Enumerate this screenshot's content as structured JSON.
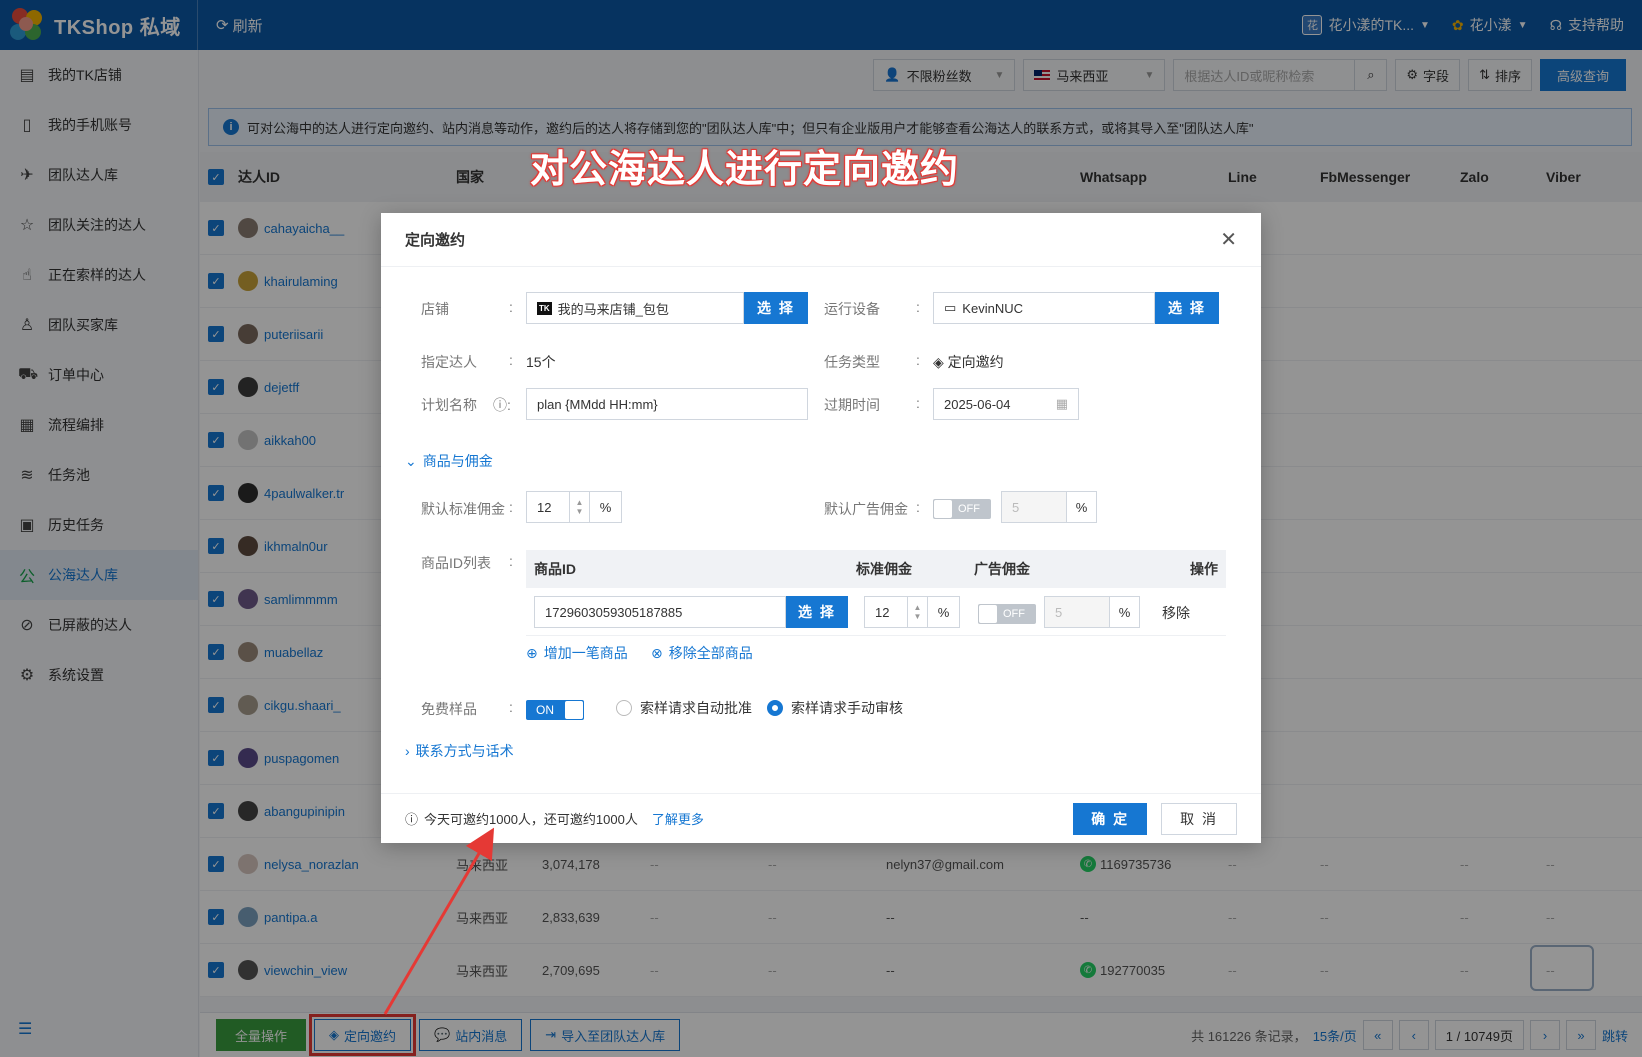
{
  "app": {
    "title": "TKShop 私域",
    "refresh": "刷新"
  },
  "header": {
    "shop_badge": "花",
    "shop": "花小漾的TK...",
    "user": "花小漾",
    "help": "支持帮助"
  },
  "sidebar": {
    "items": [
      {
        "label": "我的TK店铺",
        "icon": "shop-icon"
      },
      {
        "label": "我的手机账号",
        "icon": "phone-icon"
      },
      {
        "label": "团队达人库",
        "icon": "creator-icon"
      },
      {
        "label": "团队关注的达人",
        "icon": "star-icon"
      },
      {
        "label": "正在索样的达人",
        "icon": "hand-icon"
      },
      {
        "label": "团队买家库",
        "icon": "buyer-icon"
      },
      {
        "label": "订单中心",
        "icon": "truck-icon"
      },
      {
        "label": "流程编排",
        "icon": "calendar-icon"
      },
      {
        "label": "任务池",
        "icon": "layers-icon"
      },
      {
        "label": "历史任务",
        "icon": "history-icon"
      },
      {
        "label": "公海达人库",
        "icon": "public-pool-icon"
      },
      {
        "label": "已屏蔽的达人",
        "icon": "blocked-icon"
      },
      {
        "label": "系统设置",
        "icon": "gear-icon"
      }
    ],
    "active_index": 10
  },
  "toolbar": {
    "fans_filter": "不限粉丝数",
    "country": "马来西亚",
    "search_placeholder": "根据达人ID或昵称检索",
    "fields": "字段",
    "sort": "排序",
    "advanced": "高级查询"
  },
  "info": "可对公海中的达人进行定向邀约、站内消息等动作，邀约后的达人将存储到您的\"团队达人库\"中；但只有企业版用户才能够查看公海达人的联系方式，或将其导入至\"团队达人库\"",
  "overlay_title": "对公海达人进行定向邀约",
  "table": {
    "headers": {
      "id": "达人ID",
      "country": "国家",
      "whatsapp": "Whatsapp",
      "line": "Line",
      "fbm": "FbMessenger",
      "zalo": "Zalo",
      "viber": "Viber"
    },
    "rows": [
      {
        "id": "cahayaicha__"
      },
      {
        "id": "khairulaming"
      },
      {
        "id": "puteriisarii"
      },
      {
        "id": "dejetff"
      },
      {
        "id": "aikkah00"
      },
      {
        "id": "4paulwalker.tr"
      },
      {
        "id": "ikhmaln0ur"
      },
      {
        "id": "samlimmmm"
      },
      {
        "id": "muabellaz"
      },
      {
        "id": "cikgu.shaari_"
      },
      {
        "id": "puspagomen"
      },
      {
        "id": "abangupinipin"
      },
      {
        "id": "nelysa_norazlan",
        "country": "马来西亚",
        "fans": "3,074,178",
        "d1": "--",
        "d2": "--",
        "email": "nelyn37@gmail.com",
        "wa": "1169735736",
        "line": "--",
        "fbm": "--",
        "zalo": "--",
        "viber": "--"
      },
      {
        "id": "pantipa.a",
        "country": "马来西亚",
        "fans": "2,833,639",
        "d1": "--",
        "d2": "--",
        "email": "--",
        "wa": "--",
        "line": "--",
        "fbm": "--",
        "zalo": "--",
        "viber": "--"
      },
      {
        "id": "viewchin_view",
        "country": "马来西亚",
        "fans": "2,709,695",
        "d1": "--",
        "d2": "--",
        "email": "--",
        "wa": "192770035",
        "line": "--",
        "fbm": "--",
        "zalo": "--",
        "viber": "--"
      }
    ]
  },
  "bottom": {
    "all_ops": "全量操作",
    "invite": "定向邀约",
    "message": "站内消息",
    "import": "导入至团队达人库",
    "total": "共 161226 条记录，",
    "per_page": "15条/页",
    "page": "1 / 10749页",
    "jump": "跳转"
  },
  "modal": {
    "title": "定向邀约",
    "shop_label": "店铺",
    "shop_value": "我的马来店铺_包包",
    "shop_badge": "TK",
    "select": "选 择",
    "device_label": "运行设备",
    "device_value": "KevinNUC",
    "creators_label": "指定达人",
    "creators_value": "15个",
    "task_type_label": "任务类型",
    "task_type_value": "定向邀约",
    "plan_label": "计划名称",
    "plan_value": "plan {MMdd HH:mm}",
    "expire_label": "过期时间",
    "expire_value": "2025-06-04",
    "section_products": "商品与佣金",
    "default_comm_label": "默认标准佣金",
    "default_comm_value": "12",
    "percent": "%",
    "ad_comm_label": "默认广告佣金",
    "ad_comm_toggle": "OFF",
    "ad_comm_value": "5",
    "product_list_label": "商品ID列表",
    "product_headers": {
      "id": "商品ID",
      "std": "标准佣金",
      "ad": "广告佣金",
      "op": "操作"
    },
    "product_row": {
      "id": "1729603059305187885",
      "std": "12",
      "ad_toggle": "OFF",
      "ad": "5",
      "remove": "移除"
    },
    "add_product": "增加一笔商品",
    "remove_all": "移除全部商品",
    "free_sample_label": "免费样品",
    "free_sample_toggle": "ON",
    "radio_auto": "索样请求自动批准",
    "radio_manual": "索样请求手动审核",
    "section_contact": "联系方式与话术",
    "quota": "今天可邀约1000人，还可邀约1000人",
    "learn_more": "了解更多",
    "ok": "确 定",
    "cancel": "取 消"
  },
  "colors": {
    "primary": "#1677d2",
    "header": "#0c58a6",
    "green": "#3a9d3e",
    "annotation": "#e53935"
  }
}
